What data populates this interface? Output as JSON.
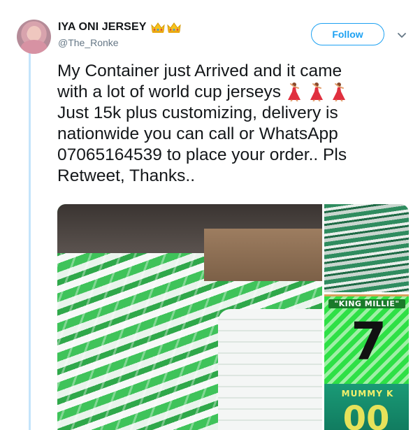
{
  "user": {
    "display_name": "IYA ONI JERSEY",
    "handle": "@The_Ronke"
  },
  "header": {
    "follow_label": "Follow"
  },
  "tweet": {
    "lines": [
      "My Container just Arrived and it came",
      "with a lot of world cup jerseys",
      "Just 15k plus customizing, delivery is",
      "nationwide you can call or WhatsApp",
      "07065164539 to place your order.. Pls",
      "Retweet, Thanks.."
    ]
  },
  "media": {
    "jersey_name_1": "\"KING MILLIE\"",
    "jersey_number_1": "7",
    "jersey_name_2": "MUMMY K",
    "jersey_number_2": "00"
  },
  "colors": {
    "accent": "#1da1f2",
    "thread_line": "#c4e4fb",
    "secondary_text": "#657786"
  },
  "icons": {
    "crown": "crown-icon",
    "dancer": "dancer-icon",
    "caret": "chevron-down-icon"
  }
}
